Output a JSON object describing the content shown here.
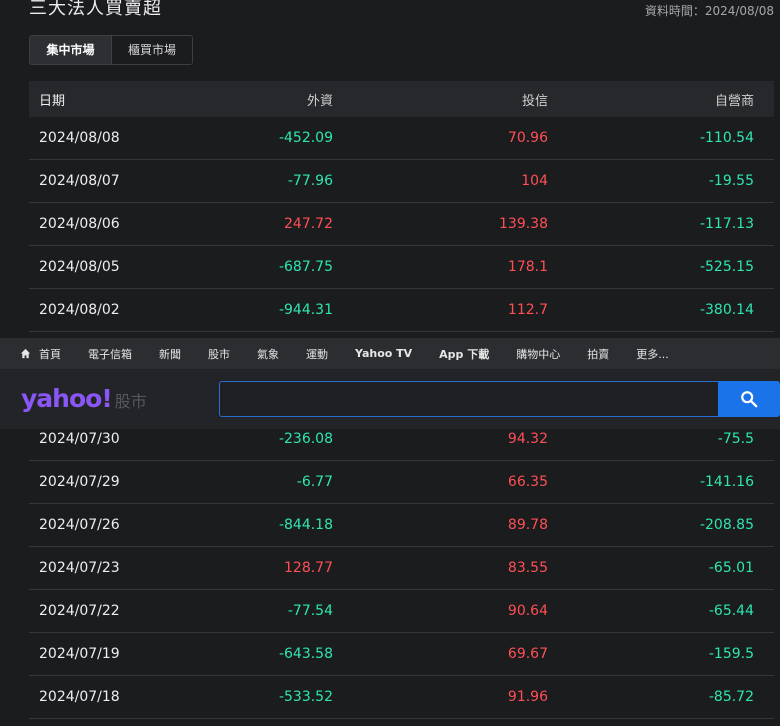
{
  "page": {
    "title": "三大法人買賣超",
    "data_time": "資料時間：2024/08/08"
  },
  "tabs": [
    {
      "label": "集中市場",
      "active": true
    },
    {
      "label": "櫃買市場",
      "active": false
    }
  ],
  "table": {
    "headers": [
      "日期",
      "外資",
      "投信",
      "自營商"
    ],
    "rows_top": [
      {
        "date": "2024/08/08",
        "foreign": "-452.09",
        "trust": "70.96",
        "dealer": "-110.54"
      },
      {
        "date": "2024/08/07",
        "foreign": "-77.96",
        "trust": "104",
        "dealer": "-19.55"
      },
      {
        "date": "2024/08/06",
        "foreign": "247.72",
        "trust": "139.38",
        "dealer": "-117.13"
      },
      {
        "date": "2024/08/05",
        "foreign": "-687.75",
        "trust": "178.1",
        "dealer": "-525.15"
      },
      {
        "date": "2024/08/02",
        "foreign": "-944.31",
        "trust": "112.7",
        "dealer": "-380.14"
      }
    ],
    "rows_bottom": [
      {
        "date": "2024/07/30",
        "foreign": "-236.08",
        "trust": "94.32",
        "dealer": "-75.5"
      },
      {
        "date": "2024/07/29",
        "foreign": "-6.77",
        "trust": "66.35",
        "dealer": "-141.16"
      },
      {
        "date": "2024/07/26",
        "foreign": "-844.18",
        "trust": "89.78",
        "dealer": "-208.85"
      },
      {
        "date": "2024/07/23",
        "foreign": "128.77",
        "trust": "83.55",
        "dealer": "-65.01"
      },
      {
        "date": "2024/07/22",
        "foreign": "-77.54",
        "trust": "90.64",
        "dealer": "-65.44"
      },
      {
        "date": "2024/07/19",
        "foreign": "-643.58",
        "trust": "69.67",
        "dealer": "-159.5"
      },
      {
        "date": "2024/07/18",
        "foreign": "-533.52",
        "trust": "91.96",
        "dealer": "-85.72"
      }
    ]
  },
  "nav": {
    "items": [
      "首頁",
      "電子信箱",
      "新聞",
      "股市",
      "氣象",
      "運動",
      "Yahoo TV",
      "App 下載",
      "購物中心",
      "拍賣",
      "更多..."
    ],
    "icon": "home-icon"
  },
  "logo": {
    "word": "yahoo!",
    "sub": "股市"
  },
  "search": {
    "value": "",
    "placeholder": "",
    "icon": "search-icon"
  },
  "colors": {
    "up": "#ff4f55",
    "down": "#2ee6b0",
    "accent": "#1a73e8",
    "brand": "#8a56f5"
  }
}
